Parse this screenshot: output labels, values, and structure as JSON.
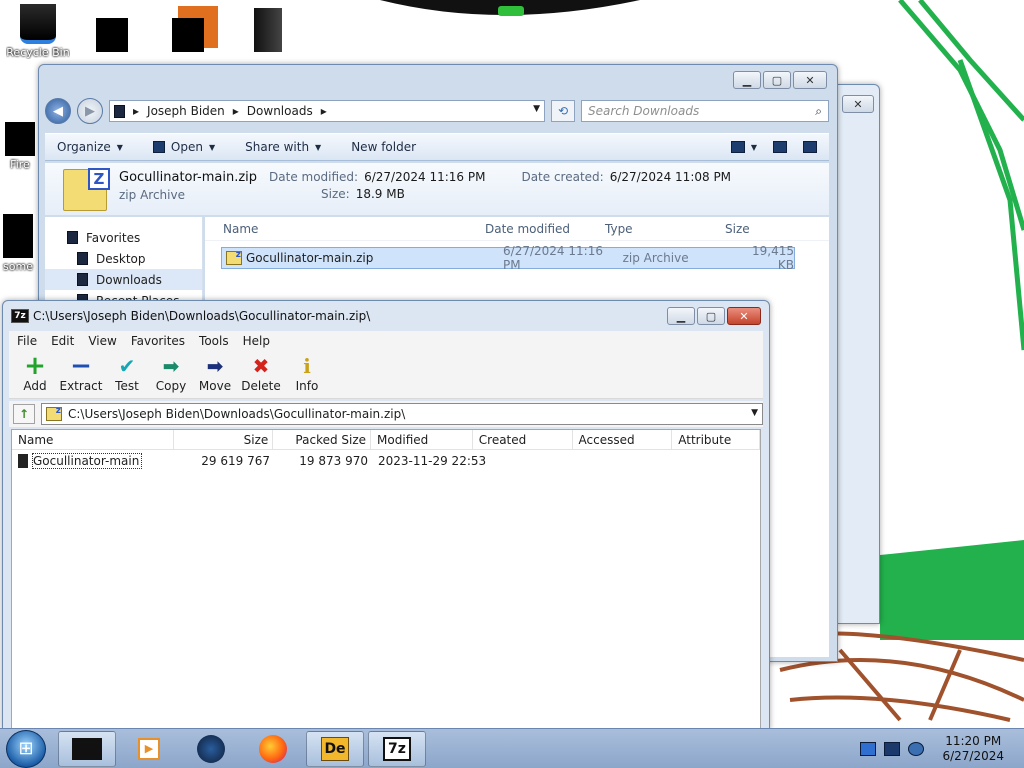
{
  "desktop": {
    "icons": [
      {
        "label": "Recycle Bin",
        "icon": "recycle-bin-icon"
      },
      {
        "label": "",
        "icon": "redacted-icon"
      },
      {
        "label": "",
        "icon": "redacted-icon"
      },
      {
        "label": "",
        "icon": "monolith-icon"
      },
      {
        "label": "Fire",
        "icon": "firefox-shortcut-icon"
      },
      {
        "label": "some",
        "icon": "redacted-icon"
      }
    ]
  },
  "explorer": {
    "breadcrumb": [
      "Joseph Biden",
      "Downloads"
    ],
    "search_placeholder": "Search Downloads",
    "toolbar": {
      "organize": "Organize",
      "open": "Open",
      "share_with": "Share with",
      "new_folder": "New folder"
    },
    "details": {
      "name": "Gocullinator-main.zip",
      "type": "zip Archive",
      "date_modified_label": "Date modified:",
      "date_modified": "6/27/2024 11:16 PM",
      "date_created_label": "Date created:",
      "date_created": "6/27/2024 11:08 PM",
      "size_label": "Size:",
      "size": "18.9 MB"
    },
    "nav": {
      "favorites": "Favorites",
      "desktop": "Desktop",
      "downloads": "Downloads",
      "recent": "Recent Places"
    },
    "columns": {
      "name": "Name",
      "date_modified": "Date modified",
      "type": "Type",
      "size": "Size"
    },
    "files": [
      {
        "name": "Gocullinator-main.zip",
        "date_modified": "6/27/2024 11:16 PM",
        "type": "zip Archive",
        "size": "19,415 KB"
      }
    ]
  },
  "sevenzip": {
    "title": "C:\\Users\\Joseph Biden\\Downloads\\Gocullinator-main.zip\\",
    "menu": [
      "File",
      "Edit",
      "View",
      "Favorites",
      "Tools",
      "Help"
    ],
    "toolbar": [
      "Add",
      "Extract",
      "Test",
      "Copy",
      "Move",
      "Delete",
      "Info"
    ],
    "path": "C:\\Users\\Joseph Biden\\Downloads\\Gocullinator-main.zip\\",
    "columns": {
      "name": "Name",
      "size": "Size",
      "packed": "Packed Size",
      "modified": "Modified",
      "created": "Created",
      "accessed": "Accessed",
      "attributes": "Attribute"
    },
    "rows": [
      {
        "name": "Gocullinator-main",
        "size": "29 619 767",
        "packed": "19 873 970",
        "modified": "2023-11-29 22:53",
        "created": "",
        "accessed": ""
      }
    ]
  },
  "taskbar": {
    "items": [
      "file-manager-icon",
      "media-player-icon",
      "globe-icon",
      "firefox-icon",
      "delphi-icon",
      "7zip-icon"
    ],
    "delphi_glyph": "De",
    "sevenzip_glyph": "7z",
    "time": "11:20 PM",
    "date": "6/27/2024"
  },
  "colors": {
    "accent": "#3a6fb2",
    "paint_green": "#22b14c",
    "paint_brown": "#a0522d"
  }
}
